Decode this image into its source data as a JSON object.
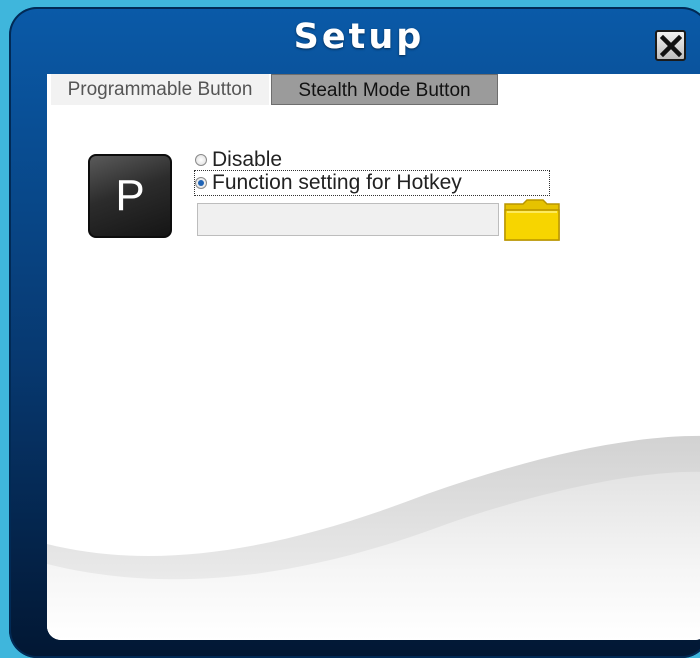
{
  "window": {
    "title": "Setup",
    "close_icon": "close-icon"
  },
  "tabs": [
    {
      "label": "Programmable Button",
      "active": true
    },
    {
      "label": "Stealth Mode Button",
      "active": false
    }
  ],
  "programmable": {
    "key_label": "P",
    "options": [
      {
        "label": "Disable",
        "selected": false
      },
      {
        "label": "Function setting for Hotkey",
        "selected": true
      }
    ],
    "hotkey_value": "",
    "browse_icon": "folder-icon"
  },
  "colors": {
    "frame": "#07386f",
    "selected_radio": "#1f63b5",
    "folder": "#f7d500"
  }
}
